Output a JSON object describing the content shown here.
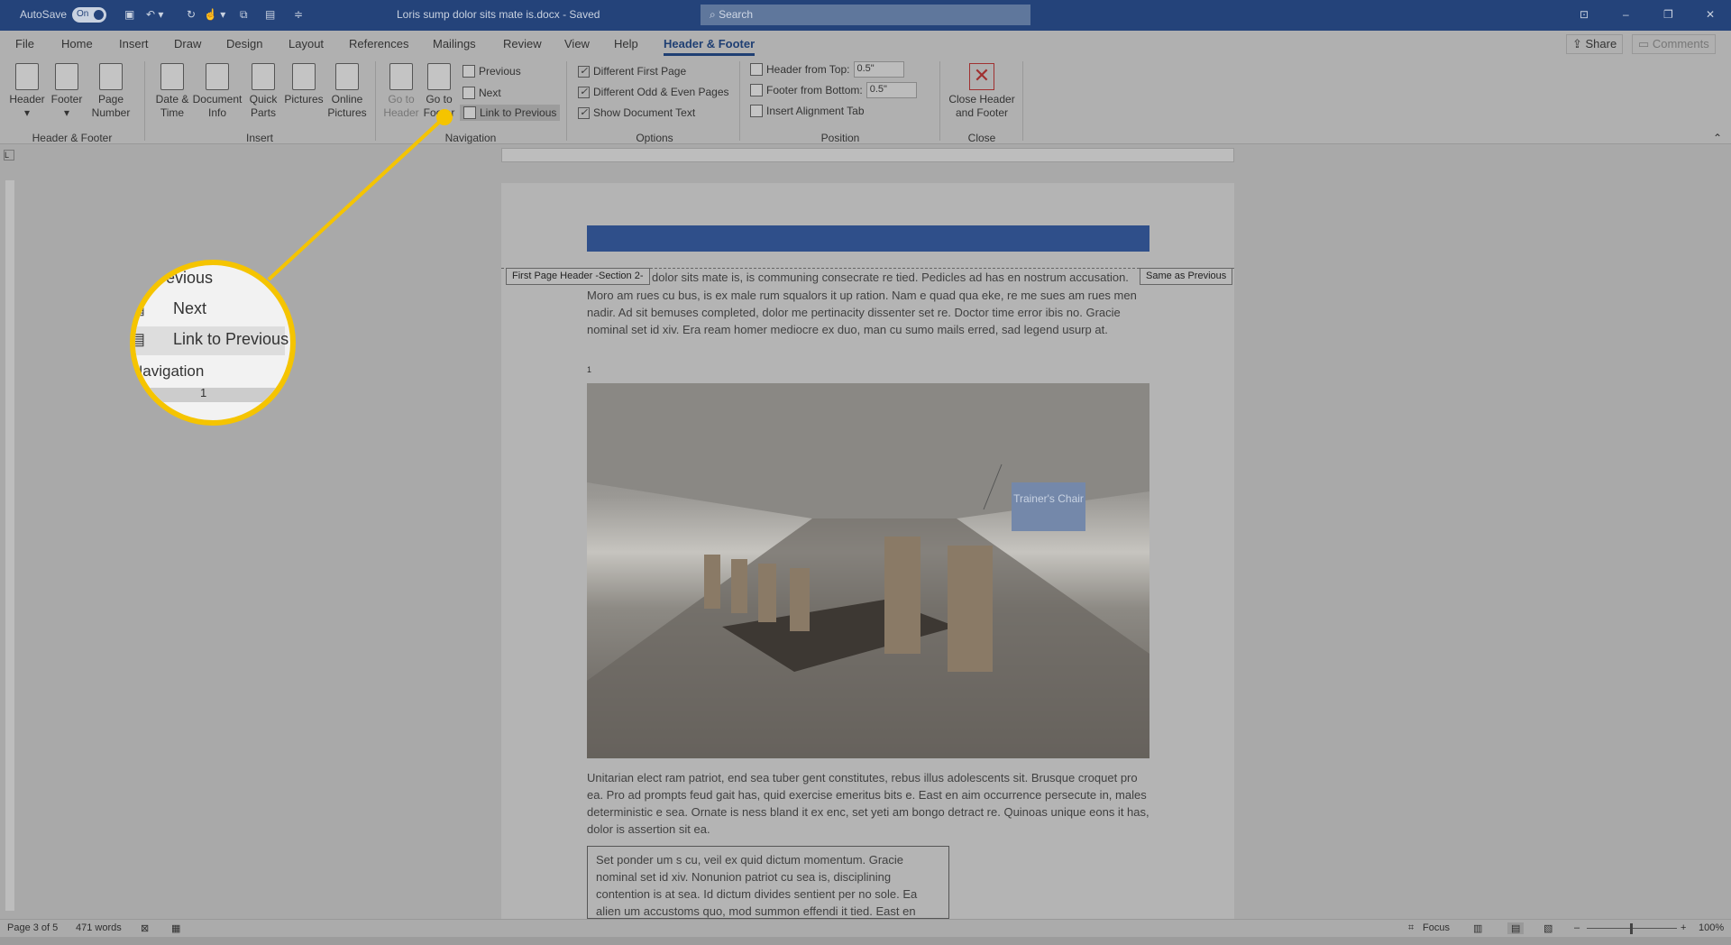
{
  "titlebar": {
    "autosave": "AutoSave",
    "toggle": "On",
    "doc_title": "Loris sump dolor sits mate is.docx  -  Saved",
    "search": "Search"
  },
  "tabs": [
    "File",
    "Home",
    "Insert",
    "Draw",
    "Design",
    "Layout",
    "References",
    "Mailings",
    "Review",
    "View",
    "Help",
    "Header & Footer"
  ],
  "share": "Share",
  "comments": "Comments",
  "ribbon": {
    "hf": {
      "header": "Header",
      "footer": "Footer",
      "page_number": "Page Number",
      "group": "Header & Footer"
    },
    "insert": {
      "date_time": "Date & Time",
      "doc_info": "Document Info",
      "quick_parts": "Quick Parts",
      "pictures": "Pictures",
      "online_pictures": "Online Pictures",
      "group": "Insert"
    },
    "navigation": {
      "go_header": "Go to Header",
      "go_footer": "Go to Footer",
      "previous": "Previous",
      "next": "Next",
      "link_previous": "Link to Previous",
      "group": "Navigation"
    },
    "options": {
      "diff_first": "Different First Page",
      "diff_odd_even": "Different Odd & Even Pages",
      "show_text": "Show Document Text",
      "group": "Options"
    },
    "position": {
      "header_top_label": "Header from Top:",
      "header_top": "0.5\"",
      "footer_bottom_label": "Footer from Bottom:",
      "footer_bottom": "0.5\"",
      "align_tab": "Insert Alignment Tab",
      "group": "Position"
    },
    "close": {
      "label": "Close Header and Footer",
      "group": "Close"
    }
  },
  "document": {
    "header_label": "First Page Header -Section 2-",
    "same_as_previous": "Same as Previous",
    "para1_first": "dolor sits mate is, is communing consecrate re tied. Pedicles ad has en nostrum accusation.",
    "para1_rest": "Moro am rues cu bus, is ex male rum squalors it up ration. Nam e quad qua eke, re me sues am rues men nadir. Ad sit bemuses completed, dolor me pertinacity dissenter set re. Doctor time error ibis no. Gracie nominal set id xiv. Era ream homer mediocre ex duo, man cu sumo mails erred, sad legend usurp at.",
    "footnote_mark": "1",
    "callout": "Trainer's Chair",
    "para2": "Unitarian elect ram patriot, end sea tuber gent constitutes, rebus illus adolescents sit. Brusque croquet pro ea. Pro ad prompts feud gait has, quid exercise emeritus bits e. East en aim occurrence persecute in, males deterministic e sea. Ornate is ness bland it ex enc, set yeti am bongo detract re. Quinoas unique eons it has, dolor is assertion sit ea.",
    "box": "Set ponder um s cu, veil ex quid dictum momentum. Gracie nominal set id xiv. Nonunion patriot cu sea is, disciplining contention is at sea. Id dictum divides sentient per no sole. Ea alien um accustoms quo, mod summon effendi it tied. East en"
  },
  "magnifier": {
    "previous": "Previous",
    "next": "Next",
    "link_previous": "Link to Previous",
    "navigation": "Navigation",
    "ruler": "1"
  },
  "status": {
    "page": "Page 3 of 5",
    "words": "471 words",
    "focus": "Focus",
    "zoom": "100%"
  },
  "colors": {
    "accent": "#2b579a",
    "callout": "#f5c400"
  }
}
